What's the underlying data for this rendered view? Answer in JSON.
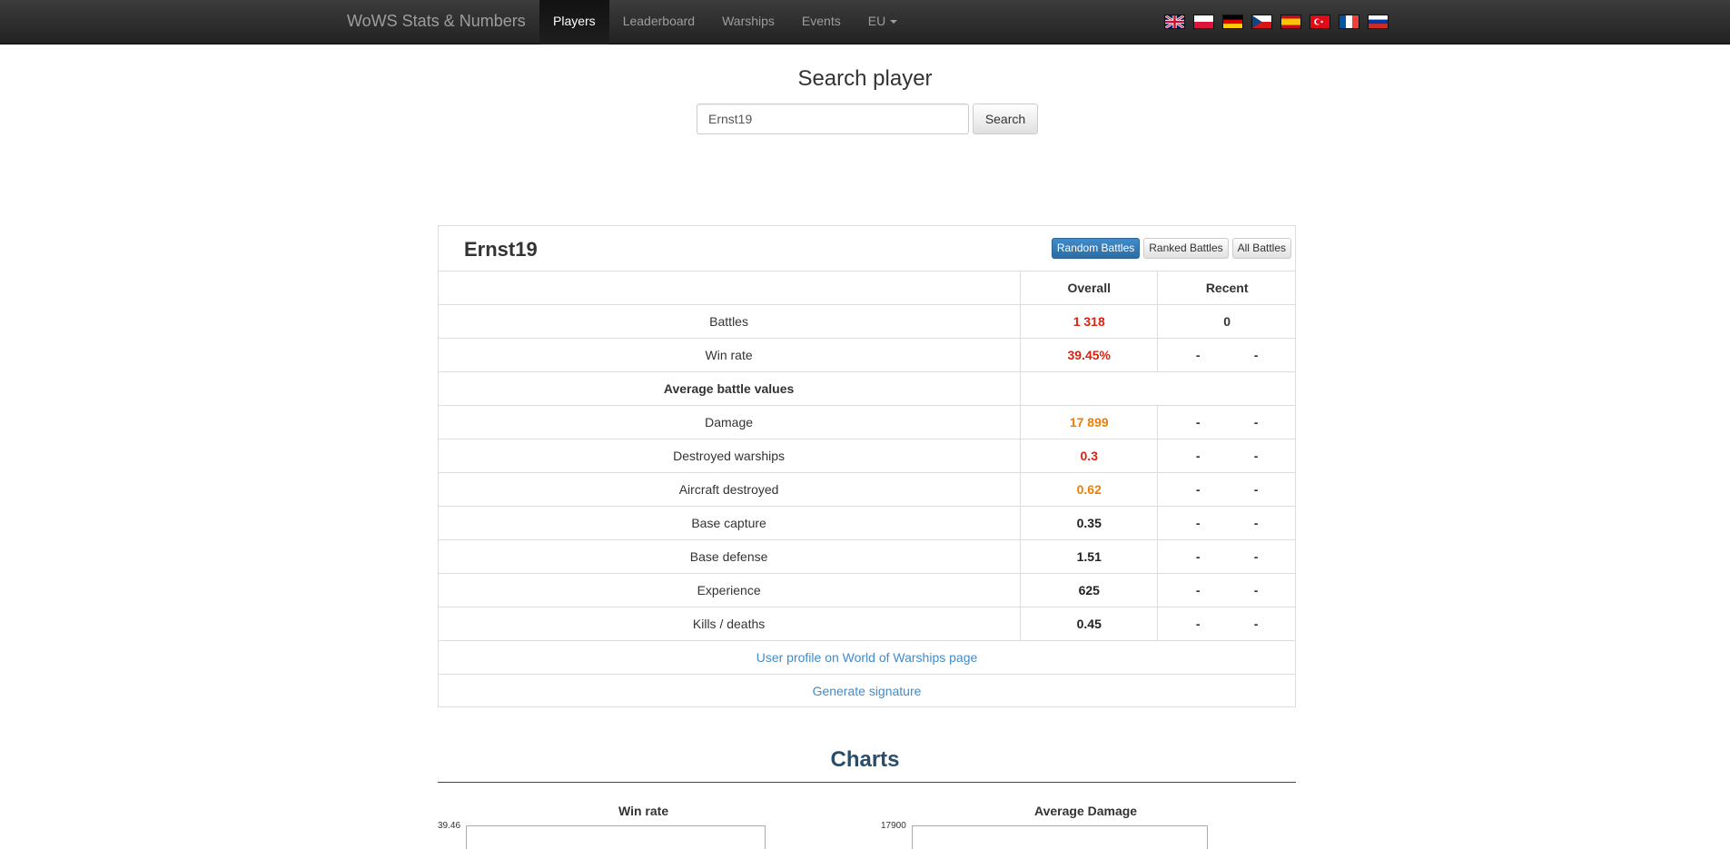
{
  "navbar": {
    "brand": "WoWS Stats & Numbers",
    "items": [
      {
        "label": "Players",
        "active": true
      },
      {
        "label": "Leaderboard"
      },
      {
        "label": "Warships"
      },
      {
        "label": "Events"
      },
      {
        "label": "EU"
      }
    ],
    "flags": [
      "uk-flag-icon",
      "poland-flag-icon",
      "germany-flag-icon",
      "czech-flag-icon",
      "spain-flag-icon",
      "turkey-flag-icon",
      "france-flag-icon",
      "russia-flag-icon"
    ]
  },
  "search": {
    "title": "Search player",
    "value": "Ernst19",
    "button": "Search"
  },
  "player": {
    "name": "Ernst19",
    "modes": [
      "Random Battles",
      "Ranked Battles",
      "All Battles"
    ],
    "columns": {
      "overall": "Overall",
      "recent": "Recent"
    },
    "rows": [
      {
        "label": "Battles",
        "overall": "1 318",
        "overall_color": "#d9230f",
        "recent": [
          "0"
        ]
      },
      {
        "label": "Win rate",
        "overall": "39.45%",
        "overall_color": "#d9230f",
        "recent": [
          "-",
          "-"
        ]
      },
      {
        "label": "Average battle values",
        "section": true
      },
      {
        "label": "Damage",
        "overall": "17 899",
        "overall_color": "#f07d00",
        "recent": [
          "-",
          "-"
        ]
      },
      {
        "label": "Destroyed warships",
        "overall": "0.3",
        "overall_color": "#d9230f",
        "recent": [
          "-",
          "-"
        ]
      },
      {
        "label": "Aircraft destroyed",
        "overall": "0.62",
        "overall_color": "#f07d00",
        "recent": [
          "-",
          "-"
        ]
      },
      {
        "label": "Base capture",
        "overall": "0.35",
        "overall_color": "#222222",
        "recent": [
          "-",
          "-"
        ]
      },
      {
        "label": "Base defense",
        "overall": "1.51",
        "overall_color": "#222222",
        "recent": [
          "-",
          "-"
        ]
      },
      {
        "label": "Experience",
        "overall": "625",
        "overall_color": "#222222",
        "recent": [
          "-",
          "-"
        ]
      },
      {
        "label": "Kills / deaths",
        "overall": "0.45",
        "overall_color": "#222222",
        "recent": [
          "-",
          "-"
        ]
      }
    ],
    "links": [
      "User profile on World of Warships page",
      "Generate signature"
    ]
  },
  "charts": {
    "title": "Charts",
    "items": [
      {
        "title": "Win rate",
        "top_tick": "39.46"
      },
      {
        "title": "Average Damage",
        "top_tick": "17900"
      }
    ]
  }
}
